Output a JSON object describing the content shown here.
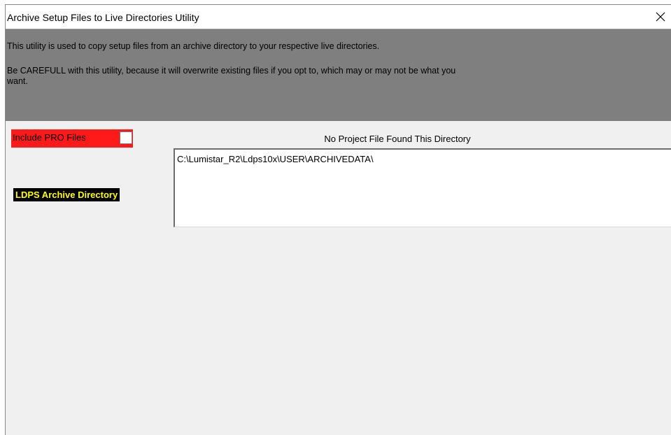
{
  "window": {
    "title": "Archive Setup Files to Live Directories Utility",
    "close_icon": "close-icon"
  },
  "info": {
    "line1": "This utility is used to copy setup files from an archive directory to your respective live directories.",
    "line2": "Be CAREFULL with this utility, because it will overwrite existing files if you opt to, which may or may not be what you",
    "line3": "want."
  },
  "options": {
    "include_pro_label": "Include PRO Files",
    "include_pro_checked": false
  },
  "status": {
    "message": "No Project File Found This Directory"
  },
  "archive": {
    "label": "LDPS Archive Directory",
    "path": "C:\\Lumistar_R2\\Ldps10x\\USER\\ARCHIVEDATA\\"
  },
  "colors": {
    "info_panel": "#7f7f7f",
    "pro_background": "#ff1a1a",
    "archive_label_bg": "#000000",
    "archive_label_fg": "#ffff00",
    "window_bg": "#f0f0f0"
  }
}
